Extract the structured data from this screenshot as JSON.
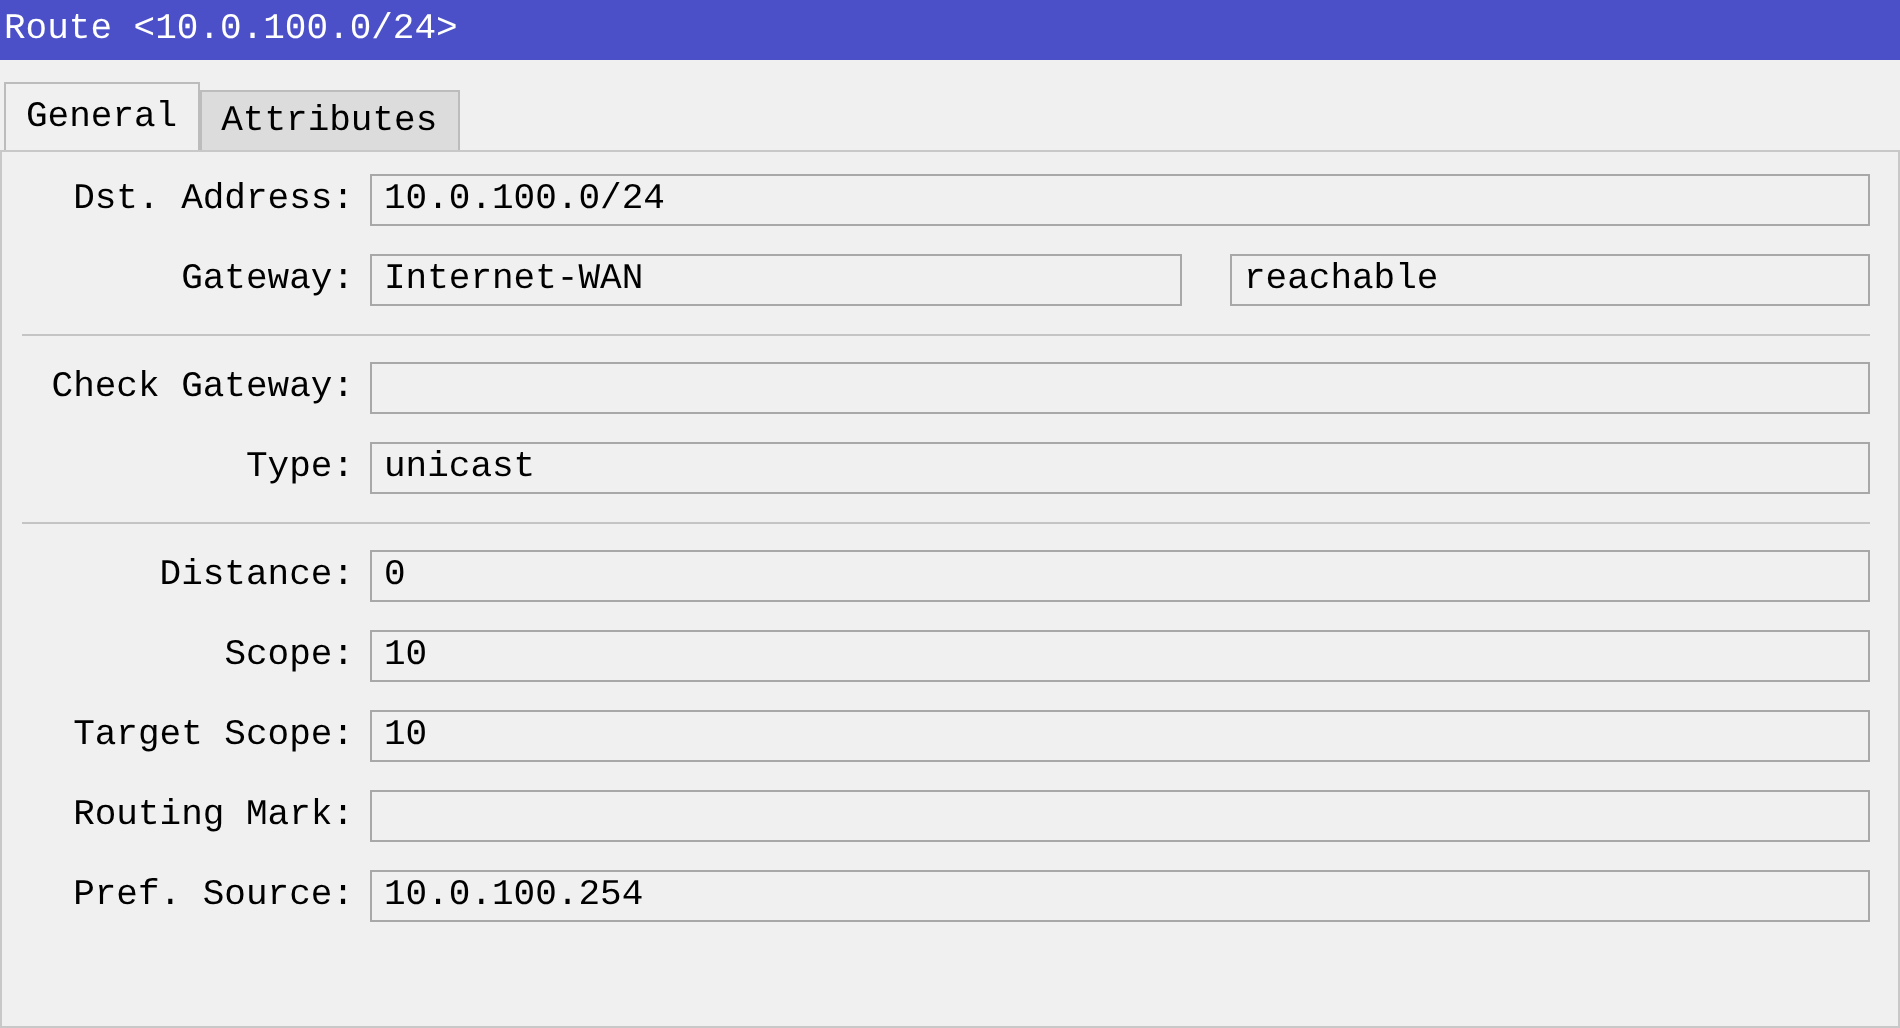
{
  "window": {
    "title": "Route <10.0.100.0/24>"
  },
  "tabs": [
    {
      "label": "General",
      "selected": true
    },
    {
      "label": "Attributes",
      "selected": false
    }
  ],
  "sections": [
    {
      "fields": [
        {
          "label": "Dst. Address:",
          "value": "10.0.100.0/24"
        },
        {
          "label": "Gateway:",
          "value": "Internet-WAN",
          "status": "reachable"
        }
      ]
    },
    {
      "fields": [
        {
          "label": "Check Gateway:"
        },
        {
          "label": "Type:",
          "value": "unicast"
        }
      ]
    },
    {
      "fields": [
        {
          "label": "Distance:",
          "value": "0"
        },
        {
          "label": "Scope:",
          "value": "10"
        },
        {
          "label": "Target Scope:",
          "value": "10"
        },
        {
          "label": "Routing Mark:"
        },
        {
          "label": "Pref. Source:",
          "value": "10.0.100.254"
        }
      ]
    }
  ]
}
